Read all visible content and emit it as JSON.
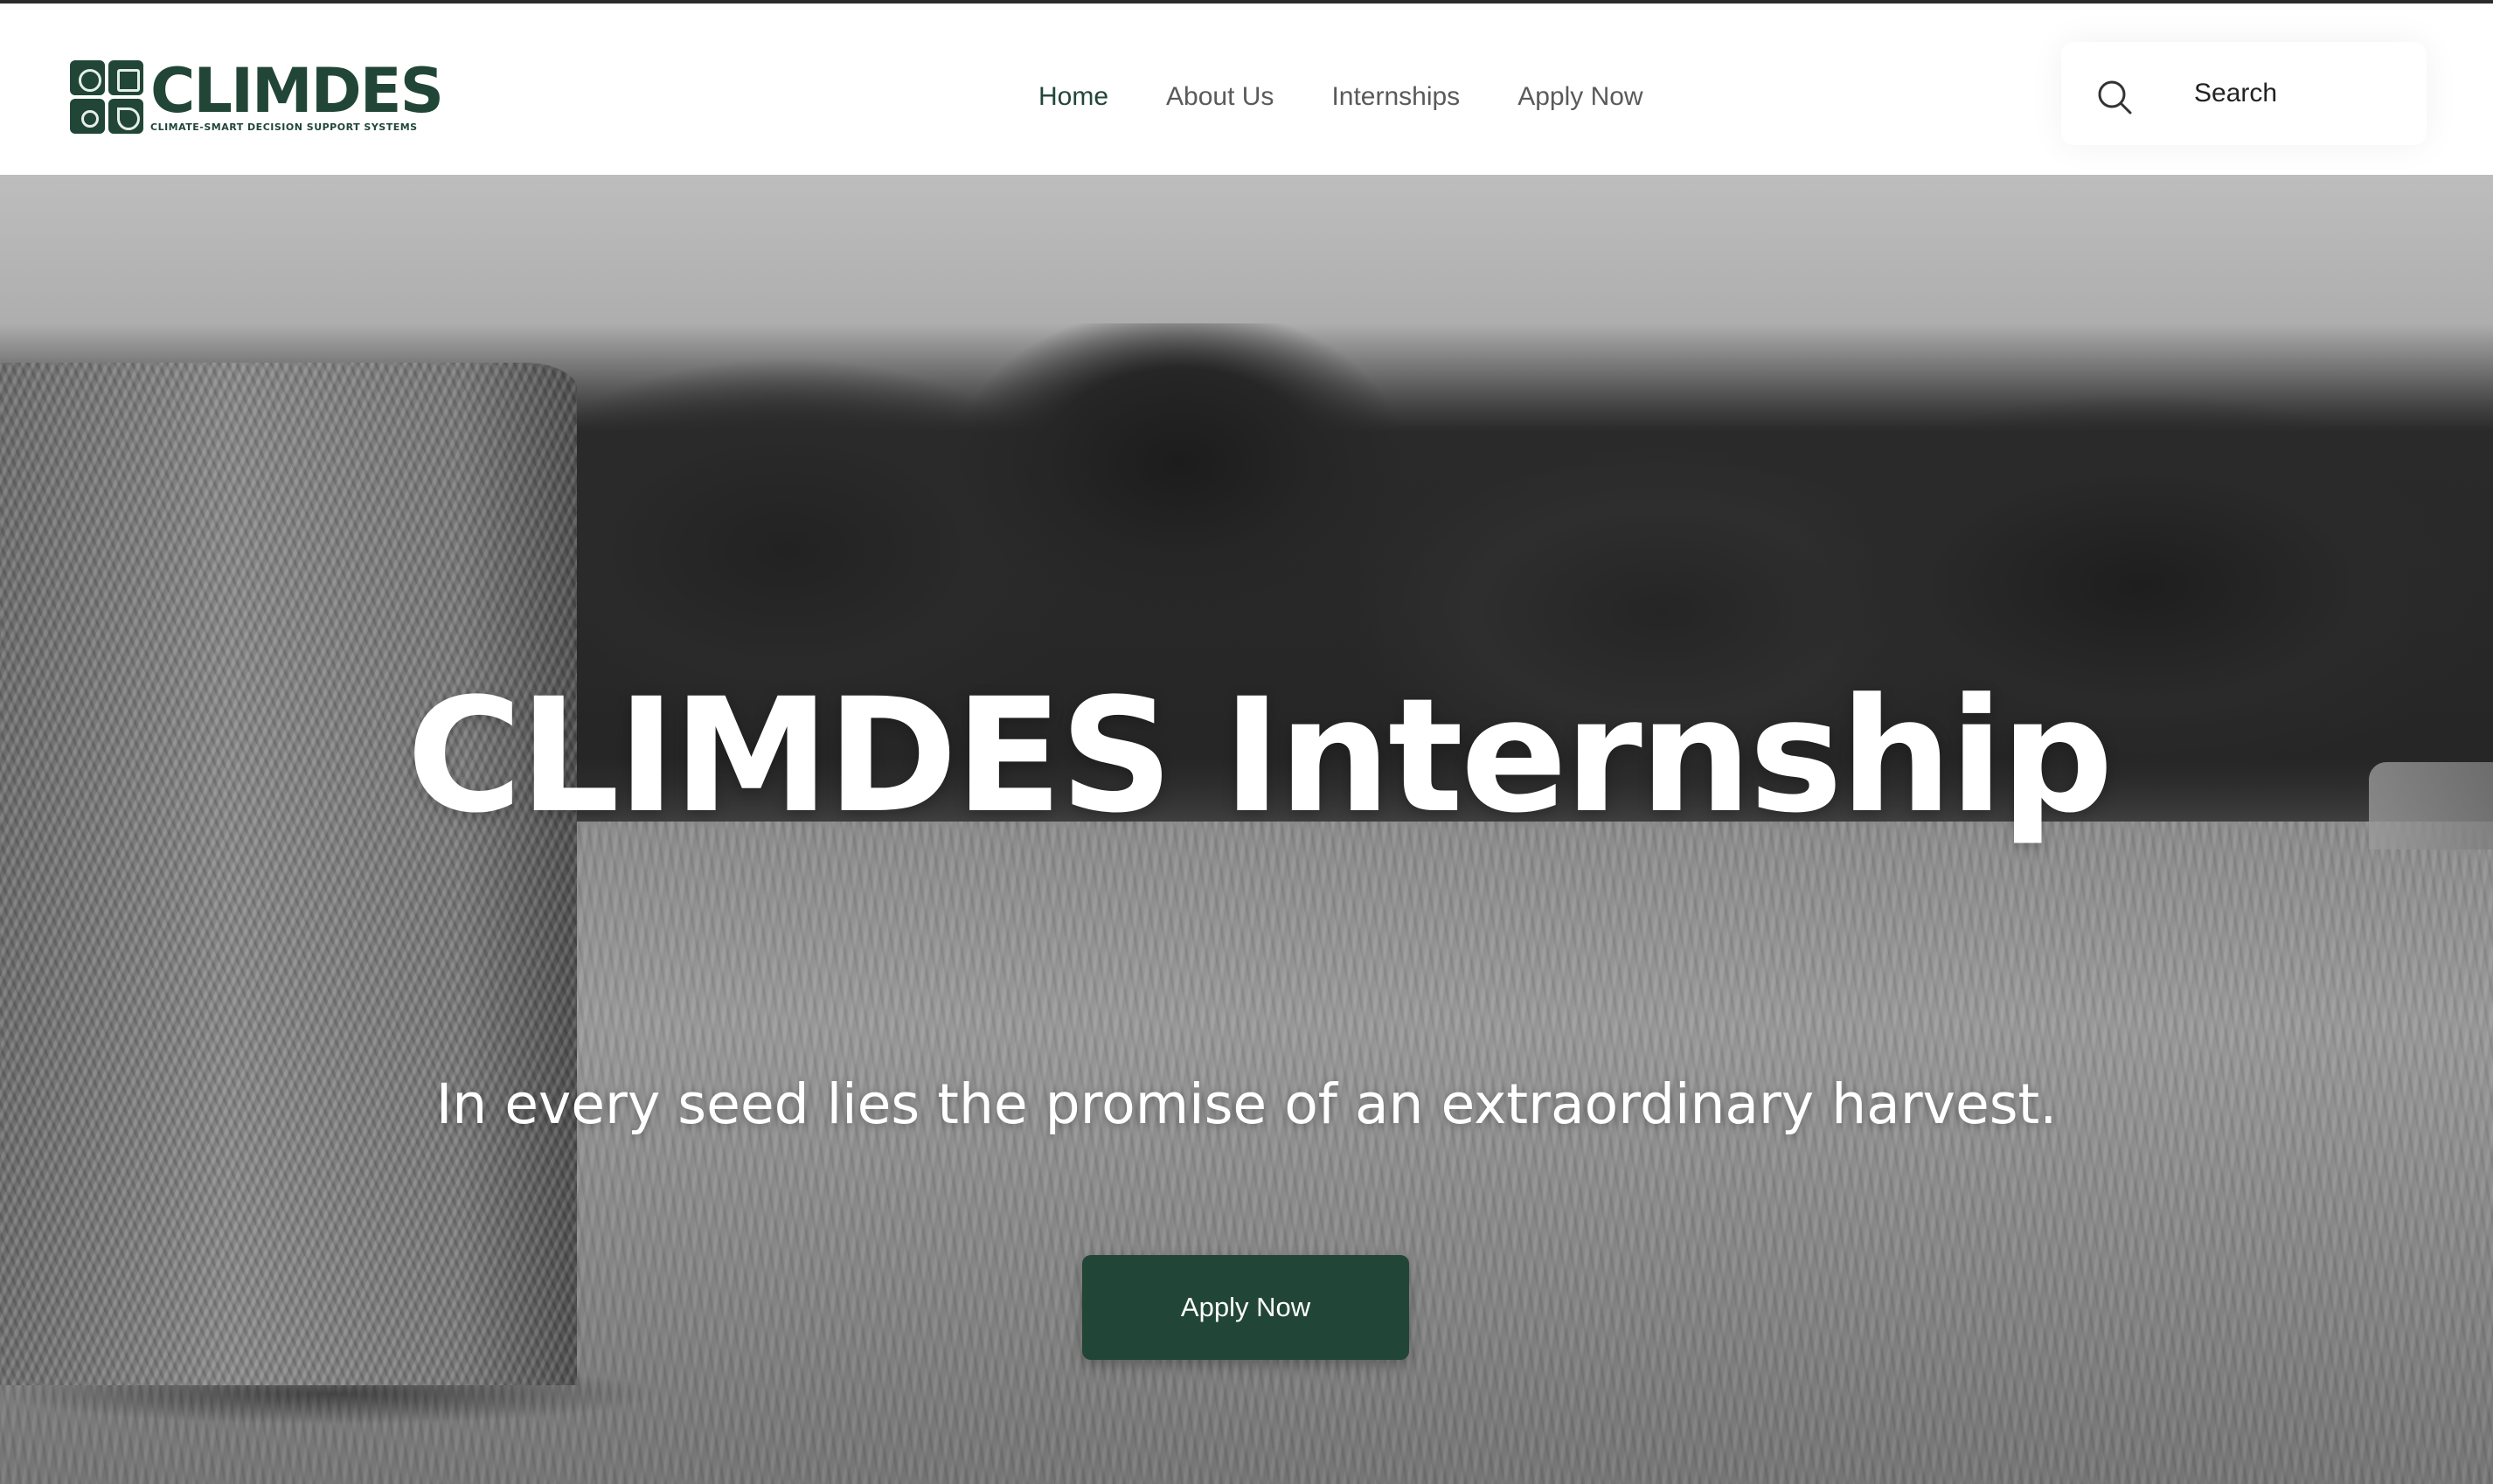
{
  "brand": {
    "name": "CLIMDES",
    "tagline": "CLIMATE-SMART DECISION SUPPORT SYSTEMS",
    "primary_color": "#214637"
  },
  "nav": {
    "items": [
      {
        "label": "Home",
        "active": true
      },
      {
        "label": "About Us",
        "active": false
      },
      {
        "label": "Internships",
        "active": false
      },
      {
        "label": "Apply Now",
        "active": false
      }
    ]
  },
  "search": {
    "icon": "search-icon",
    "label": "Search"
  },
  "hero": {
    "title": "CLIMDES Internship",
    "subtitle": "In every seed lies the promise of an extraordinary harvest.",
    "cta_label": "Apply Now"
  }
}
